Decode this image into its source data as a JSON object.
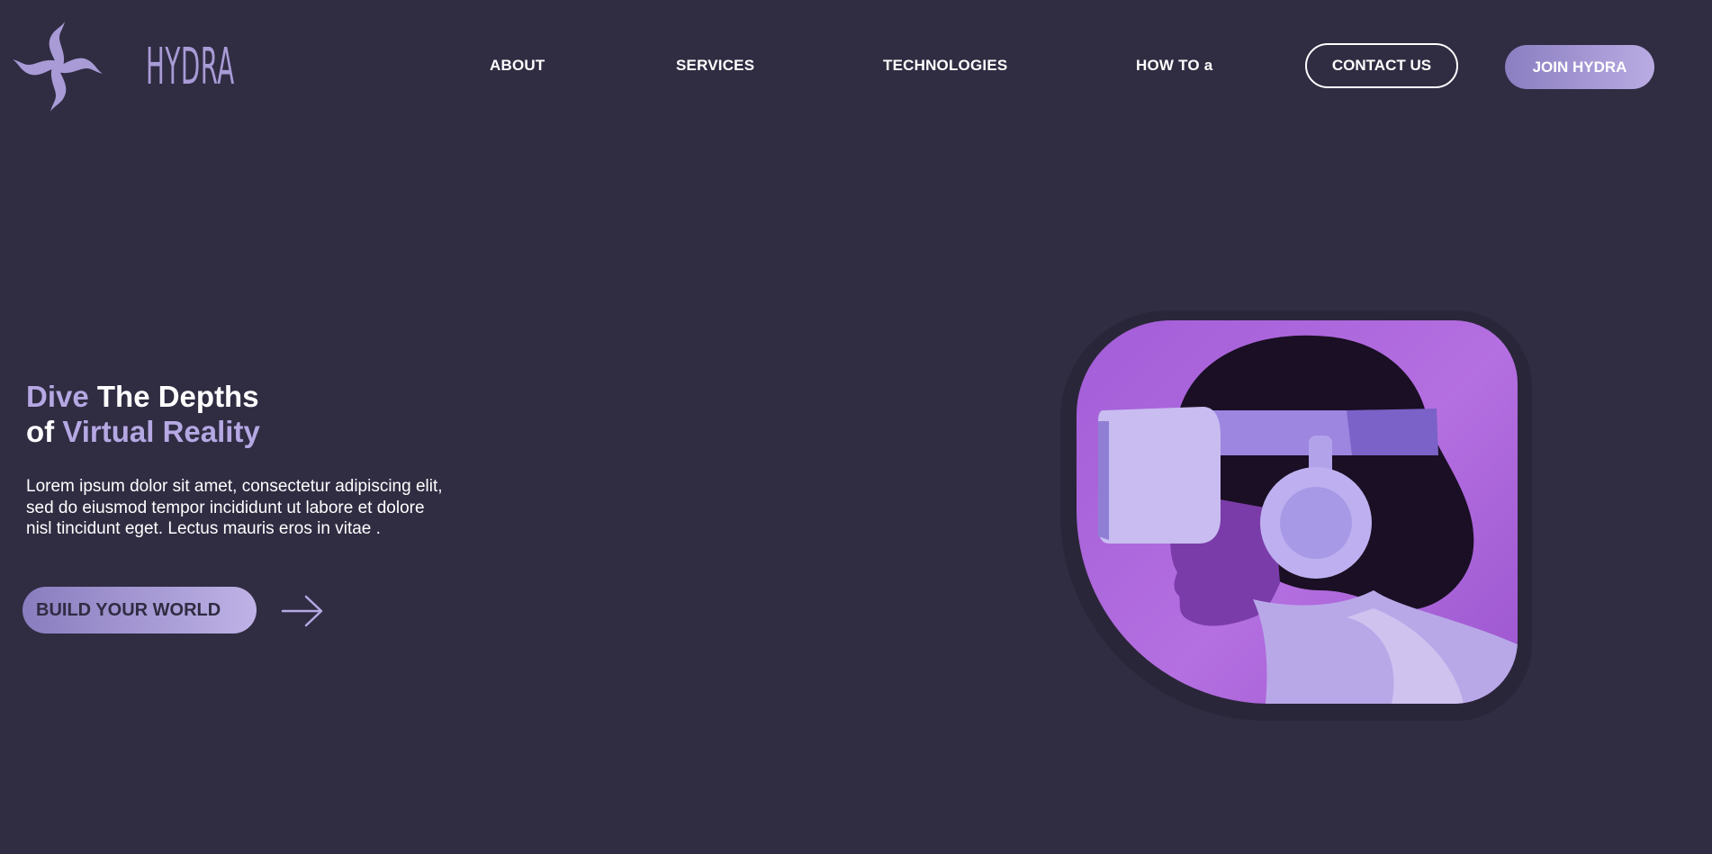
{
  "header": {
    "brand_name": "HYDRA",
    "logo_icon": "hydra-spiral-logo",
    "nav": [
      {
        "label": "ABOUT"
      },
      {
        "label": "SERVICES"
      },
      {
        "label": "TECHNOLOGIES"
      },
      {
        "label": "HOW TO a"
      }
    ],
    "contact_label": "CONTACT US",
    "join_label": "JOIN HYDRA"
  },
  "hero": {
    "title_word_1": "Dive",
    "title_word_2": " The Depths",
    "title_word_3": "of",
    "title_word_4": "Virtual Reality",
    "description_line_1": "Lorem ipsum dolor sit amet, consectetur adipiscing elit,",
    "description_line_2": "sed do eiusmod tempor incididunt ut labore et dolore",
    "description_line_3": "nisl tincidunt eget. Lectus mauris eros in vitae .",
    "cta_label": "BUILD YOUR WORLD",
    "cta_arrow_icon": "arrow-right-icon",
    "image_subject": "person-wearing-vr-headset"
  },
  "colors": {
    "background": "#302c42",
    "accent": "#b5a8e3",
    "gradient_start": "#8a7dbf",
    "gradient_end": "#beb2e6",
    "image_bg": "#a35dd8"
  }
}
